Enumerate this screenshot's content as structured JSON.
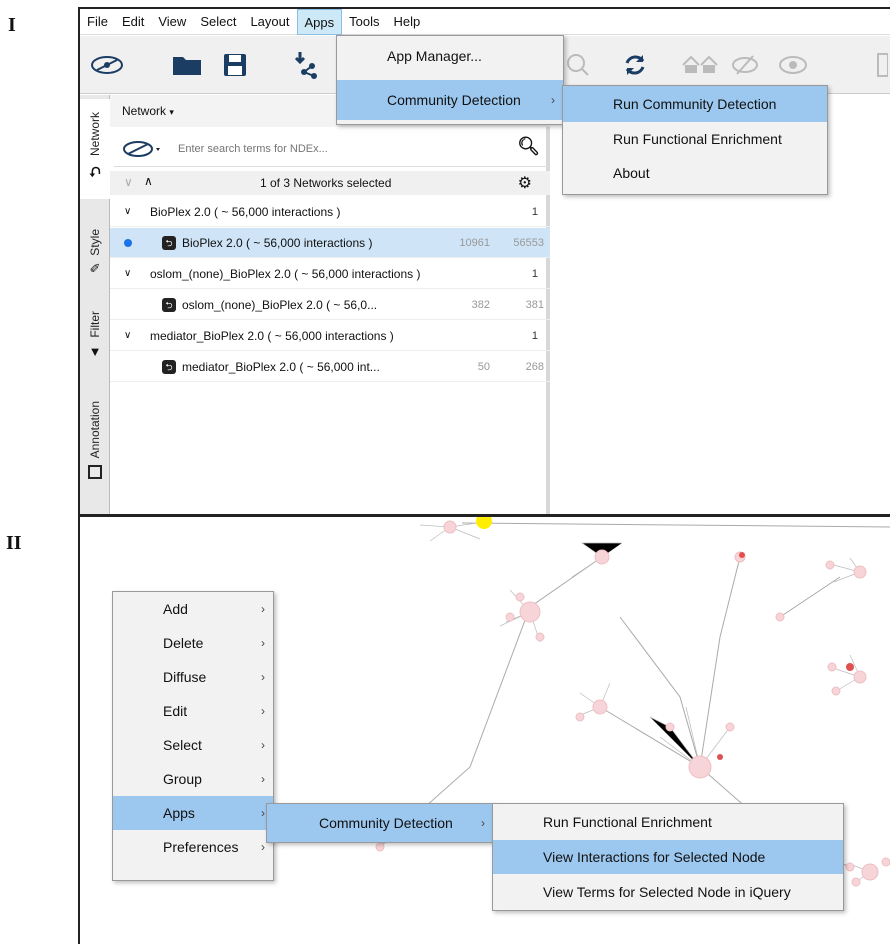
{
  "panels": {
    "top_label": "I",
    "bottom_label": "II"
  },
  "menubar": {
    "items": [
      "File",
      "Edit",
      "View",
      "Select",
      "Layout",
      "Apps",
      "Tools",
      "Help"
    ],
    "active": "Apps"
  },
  "toolbar": {
    "icons": [
      "ndex-logo-icon",
      "open-folder-icon",
      "save-icon",
      "import-network-icon",
      "zoom-icon",
      "refresh-icon",
      "home-icon",
      "hide-icon",
      "show-icon"
    ]
  },
  "apps_menu": {
    "app_manager": "App Manager...",
    "community_detection": "Community Detection",
    "submenu": {
      "items": [
        "Run Community Detection",
        "Run Functional Enrichment",
        "About"
      ],
      "highlighted": "Run Community Detection"
    }
  },
  "side_tabs": [
    "Network",
    "Style",
    "Filter",
    "Annotation"
  ],
  "network_panel": {
    "header": "Network",
    "search_placeholder": "Enter search terms for NDEx...",
    "selection_summary": "1 of 3 Networks selected",
    "collections": [
      {
        "name": "BioPlex 2.0 ( ~ 56,000 interactions )",
        "count": "1",
        "network": {
          "name": "BioPlex 2.0 ( ~ 56,000 interactions )",
          "nodes": "10961",
          "edges": "56553",
          "selected": true
        }
      },
      {
        "name": "oslom_(none)_BioPlex 2.0 ( ~ 56,000 interactions )",
        "count": "1",
        "network": {
          "name": "oslom_(none)_BioPlex 2.0 ( ~ 56,0...",
          "nodes": "382",
          "edges": "381",
          "selected": false
        }
      },
      {
        "name": "mediator_BioPlex 2.0 ( ~ 56,000 interactions )",
        "count": "1",
        "network": {
          "name": "mediator_BioPlex 2.0 ( ~ 56,000 int...",
          "nodes": "50",
          "edges": "268",
          "selected": false
        }
      }
    ]
  },
  "context_menu": {
    "items": [
      "Add",
      "Delete",
      "Diffuse",
      "Edit",
      "Select",
      "Group",
      "Apps",
      "Preferences"
    ],
    "highlighted": "Apps",
    "apps_submenu": {
      "item": "Community Detection"
    },
    "cd_submenu": {
      "items": [
        "Run Functional Enrichment",
        "View Interactions for Selected Node",
        "View Terms for Selected Node in iQuery"
      ],
      "highlighted": "View Interactions for Selected Node"
    }
  },
  "colors": {
    "highlight": "#9cc8ef",
    "selected_row": "#cfe4f7",
    "node_fill": "#f7d4d8",
    "edge": "#aaaaaa",
    "selected_node": "#ffee00"
  }
}
